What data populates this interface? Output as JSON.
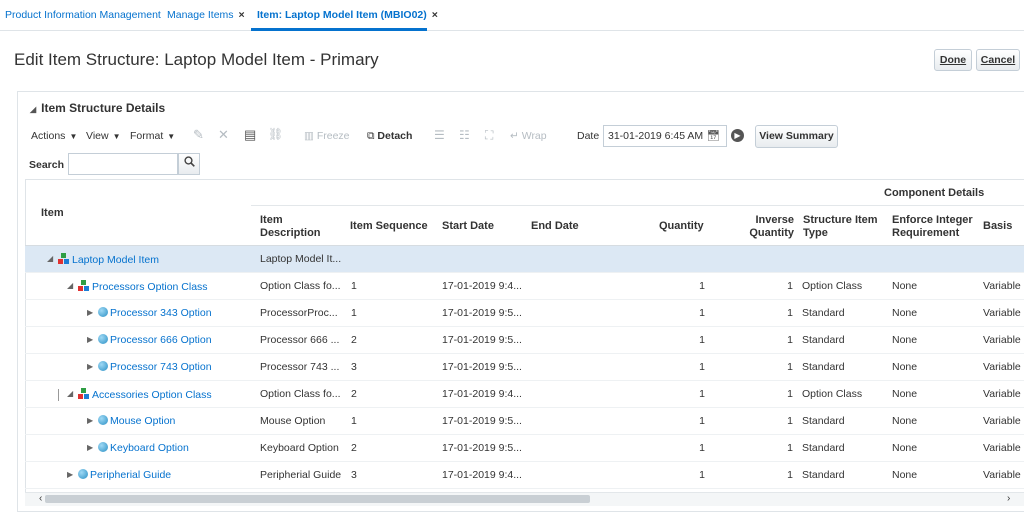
{
  "tabs": [
    {
      "label": "Product Information Management",
      "closable": false
    },
    {
      "label": "Manage Items",
      "closable": true
    },
    {
      "label": "Item: Laptop Model Item (MBIO02)",
      "closable": true
    }
  ],
  "close_glyph": "×",
  "page_title": "Edit Item Structure: Laptop Model Item - Primary",
  "buttons": {
    "done": "Done",
    "cancel": "Cancel"
  },
  "section_title": "Item Structure Details",
  "toolbar": {
    "actions": "Actions",
    "view": "View",
    "format": "Format",
    "freeze": "Freeze",
    "detach": "Detach",
    "wrap": "Wrap",
    "date_label": "Date",
    "date_value": "31-01-2019 6:45 AM",
    "view_summary": "View Summary"
  },
  "search": {
    "label": "Search",
    "placeholder": ""
  },
  "columns": {
    "group_header": "Component Details",
    "item": "Item",
    "item_description": "Item Description",
    "item_sequence": "Item Sequence",
    "start_date": "Start Date",
    "end_date": "End Date",
    "quantity": "Quantity",
    "inverse_quantity": "Inverse Quantity",
    "structure_item_type": "Structure Item Type",
    "enforce_integer": "Enforce Integer Requirement",
    "basis": "Basis"
  },
  "rows": [
    {
      "item": "Laptop Model Item",
      "icon": "structure-icon",
      "level": 0,
      "expanded": true,
      "desc": "Laptop Model It...",
      "seq": "",
      "start": "",
      "end": "",
      "qty": "",
      "inv": "",
      "type": "",
      "enforce": "",
      "basis": "",
      "selected": true
    },
    {
      "item": "Processors Option Class",
      "icon": "structure-icon",
      "level": 1,
      "expanded": true,
      "desc": "Option Class fo...",
      "seq": "1",
      "start": "17-01-2019 9:4...",
      "end": "",
      "qty": "1",
      "inv": "1",
      "type": "Option Class",
      "enforce": "None",
      "basis": "Variable",
      "selected": false
    },
    {
      "item": "Processor 343 Option",
      "icon": "item-icon",
      "level": 2,
      "expanded": false,
      "desc": "ProcessorProc...",
      "seq": "1",
      "start": "17-01-2019 9:5...",
      "end": "",
      "qty": "1",
      "inv": "1",
      "type": "Standard",
      "enforce": "None",
      "basis": "Variable",
      "selected": false
    },
    {
      "item": "Processor 666 Option",
      "icon": "item-icon",
      "level": 2,
      "expanded": false,
      "desc": "Processor 666 ...",
      "seq": "2",
      "start": "17-01-2019 9:5...",
      "end": "",
      "qty": "1",
      "inv": "1",
      "type": "Standard",
      "enforce": "None",
      "basis": "Variable",
      "selected": false
    },
    {
      "item": "Processor 743 Option",
      "icon": "item-icon",
      "level": 2,
      "expanded": false,
      "desc": "Processor 743 ...",
      "seq": "3",
      "start": "17-01-2019 9:5...",
      "end": "",
      "qty": "1",
      "inv": "1",
      "type": "Standard",
      "enforce": "None",
      "basis": "Variable",
      "selected": false
    },
    {
      "item": "Accessories Option Class",
      "icon": "structure-icon",
      "level": 1,
      "expanded": true,
      "desc": "Option Class fo...",
      "seq": "2",
      "start": "17-01-2019 9:4...",
      "end": "",
      "qty": "1",
      "inv": "1",
      "type": "Option Class",
      "enforce": "None",
      "basis": "Variable",
      "selected": false
    },
    {
      "item": "Mouse Option",
      "icon": "item-icon",
      "level": 2,
      "expanded": false,
      "desc": "Mouse Option",
      "seq": "1",
      "start": "17-01-2019 9:5...",
      "end": "",
      "qty": "1",
      "inv": "1",
      "type": "Standard",
      "enforce": "None",
      "basis": "Variable",
      "selected": false
    },
    {
      "item": "Keyboard Option",
      "icon": "item-icon",
      "level": 2,
      "expanded": false,
      "desc": "Keyboard Option",
      "seq": "2",
      "start": "17-01-2019 9:5...",
      "end": "",
      "qty": "1",
      "inv": "1",
      "type": "Standard",
      "enforce": "None",
      "basis": "Variable",
      "selected": false
    },
    {
      "item": "Peripherial Guide",
      "icon": "item-icon",
      "level": 1,
      "expanded": false,
      "desc": "Peripherial Guide",
      "seq": "3",
      "start": "17-01-2019 9:4...",
      "end": "",
      "qty": "1",
      "inv": "1",
      "type": "Standard",
      "enforce": "None",
      "basis": "Variable",
      "selected": false
    }
  ],
  "colors": {
    "link": "#0572ce",
    "selected_row": "#dce8f4",
    "border": "#dfe4e8"
  }
}
